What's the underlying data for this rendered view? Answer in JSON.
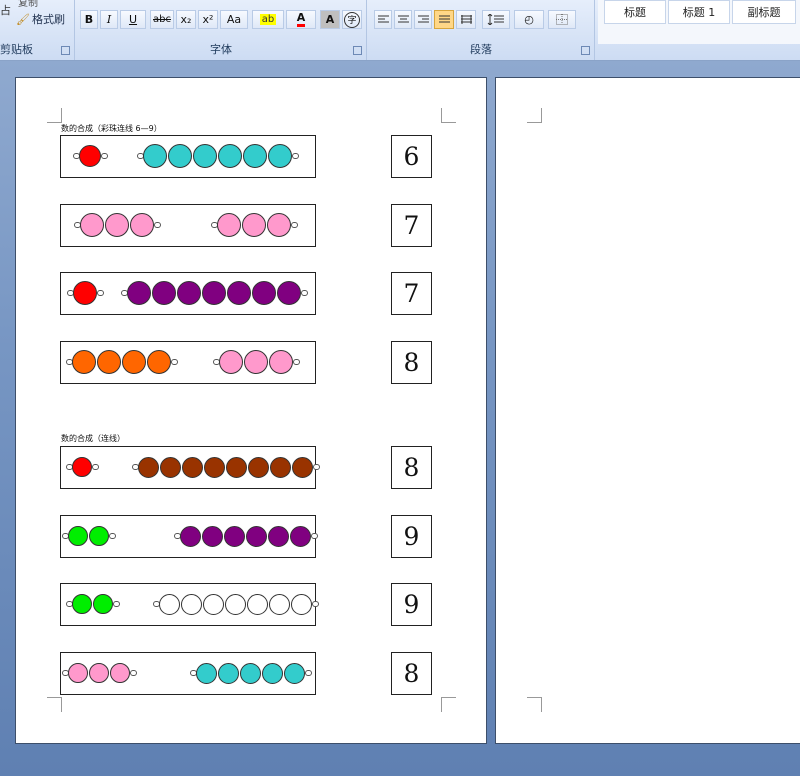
{
  "ribbon": {
    "clipboard": {
      "label": "剪贴板",
      "copy": "复制",
      "format_painter": "格式刷",
      "paste_glyph": "占"
    },
    "font": {
      "label": "字体",
      "bold": "B",
      "italic": "I",
      "underline": "U",
      "strike": "abc",
      "subscript": "x₂",
      "superscript": "x²",
      "change_case": "Aa",
      "font_color": "A",
      "char_border": "A",
      "phonetic": "字"
    },
    "paragraph": {
      "label": "段落"
    },
    "styles": [
      "标题",
      "标题 1",
      "副标题"
    ]
  },
  "document": {
    "section1_heading": "数的合成（彩珠连线 6—9）",
    "section2_heading": "数的合成（连线）",
    "rows": [
      {
        "number": "6",
        "left": {
          "count": 1,
          "color": "#ff0000"
        },
        "right": {
          "count": 6,
          "color": "#33cccc"
        }
      },
      {
        "number": "7",
        "left": {
          "count": 3,
          "color": "#ff99cc"
        },
        "right": {
          "count": 3,
          "color": "#ff99cc"
        }
      },
      {
        "number": "7",
        "left": {
          "count": 1,
          "color": "#ff0000"
        },
        "right": {
          "count": 7,
          "color": "#800080"
        }
      },
      {
        "number": "8",
        "left": {
          "count": 4,
          "color": "#ff6600"
        },
        "right": {
          "count": 3,
          "color": "#ff99cc"
        }
      },
      {
        "number": "8",
        "left": {
          "count": 1,
          "color": "#ff0000"
        },
        "right": {
          "count": 8,
          "color": "#993300"
        }
      },
      {
        "number": "9",
        "left": {
          "count": 2,
          "color": "#00ee00"
        },
        "right": {
          "count": 6,
          "color": "#800080"
        }
      },
      {
        "number": "9",
        "left": {
          "count": 2,
          "color": "#00ee00"
        },
        "right": {
          "count": 7,
          "color": "#ffffff"
        }
      },
      {
        "number": "8",
        "left": {
          "count": 3,
          "color": "#ff99cc"
        },
        "right": {
          "count": 5,
          "color": "#33cccc"
        }
      }
    ]
  }
}
